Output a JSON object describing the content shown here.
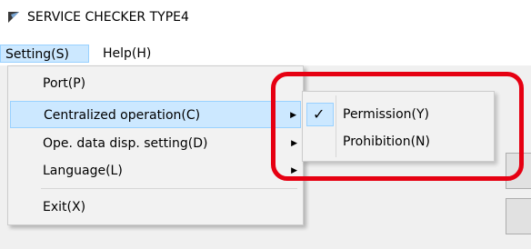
{
  "window": {
    "title": "SERVICE CHECKER TYPE4",
    "icon": "app-logo-icon"
  },
  "menubar": {
    "items": [
      {
        "label": "Setting(S)"
      },
      {
        "label": "Help(H)"
      }
    ]
  },
  "dropdown": {
    "items": [
      {
        "label": "Port(P)"
      },
      {
        "label": "Centralized operation(C)"
      },
      {
        "label": "Ope. data disp. setting(D)"
      },
      {
        "label": "Language(L)"
      },
      {
        "label": "Exit(X)"
      }
    ]
  },
  "submenu": {
    "check_mark": "✓",
    "items": [
      {
        "label": "Permission(Y)"
      },
      {
        "label": "Prohibition(N)"
      }
    ]
  },
  "colors": {
    "highlight_ring": "#e60012",
    "menu_highlight": "#cce8ff"
  }
}
